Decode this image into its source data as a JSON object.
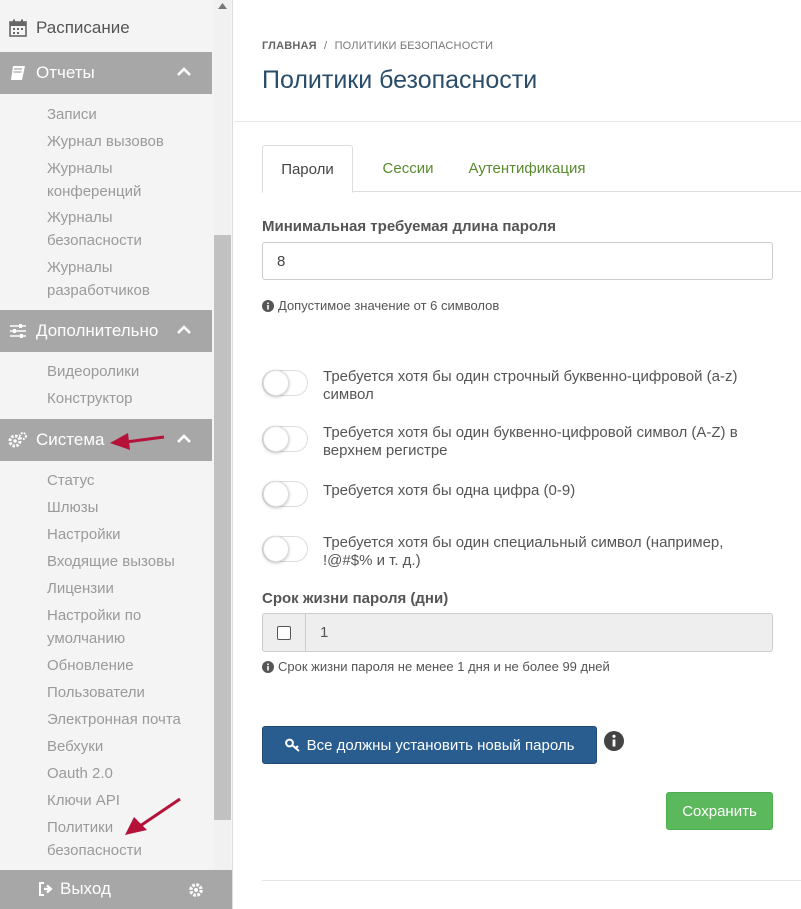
{
  "sidebar": {
    "top_item": "Расписание",
    "sections": {
      "reports": {
        "label": "Отчеты",
        "items": [
          "Записи",
          "Журнал вызовов",
          "Журналы конференций",
          "Журналы безопасности",
          "Журналы разработчиков"
        ]
      },
      "advanced": {
        "label": "Дополнительно",
        "items": [
          "Видеоролики",
          "Конструктор"
        ]
      },
      "system": {
        "label": "Система",
        "items": [
          "Статус",
          "Шлюзы",
          "Настройки",
          "Входящие вызовы",
          "Лицензии",
          "Настройки по умолчанию",
          "Обновление",
          "Пользователи",
          "Электронная почта",
          "Вебхуки",
          "Oauth 2.0",
          "Ключи API",
          "Политики безопасности"
        ]
      }
    },
    "footer": {
      "logout": "Выход"
    }
  },
  "breadcrumb": {
    "home": "ГЛАВНАЯ",
    "separator": "/",
    "current": "ПОЛИТИКИ БЕЗОПАСНОСТИ"
  },
  "page": {
    "title": "Политики безопасности"
  },
  "tabs": [
    {
      "label": "Пароли",
      "active": true
    },
    {
      "label": "Сессии",
      "active": false
    },
    {
      "label": "Аутентификация",
      "active": false
    }
  ],
  "form": {
    "min_length": {
      "label": "Минимальная требуемая длина пароля",
      "value": "8",
      "help": "Допустимое значение от 6 символов"
    },
    "toggles": [
      {
        "label": "Требуется хотя бы один строчный буквенно-цифровой (a-z) символ",
        "on": false
      },
      {
        "label": "Требуется хотя бы один буквенно-цифровой символ (A-Z) в верхнем регистре",
        "on": false
      },
      {
        "label": "Требуется хотя бы одна цифра (0-9)",
        "on": false
      },
      {
        "label": "Требуется хотя бы один специальный символ (например, !@#$% и т. д.)",
        "on": false
      }
    ],
    "lifetime": {
      "label": "Срок жизни пароля (дни)",
      "value": "1",
      "checked": false,
      "help": "Срок жизни пароля не менее 1 дня и не более 99 дней"
    },
    "reset_button": "Все должны установить новый пароль",
    "save_button": "Сохранить"
  },
  "colors": {
    "accent": "#2a5d8f",
    "success": "#5cb85c",
    "tab_link": "#5a8a2e",
    "sidebar_section": "#a7a7a7",
    "annotation_arrow": "#b5123a"
  }
}
